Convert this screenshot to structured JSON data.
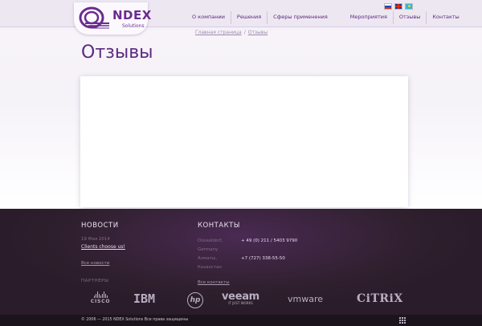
{
  "logo": {
    "name": "NDEX",
    "sub": "Solutions"
  },
  "nav": [
    {
      "label": "О компании"
    },
    {
      "label": "Решения"
    },
    {
      "label": "Сферы применения"
    },
    {
      "label": "Мероприятия"
    },
    {
      "label": "Отзывы"
    },
    {
      "label": "Контакты"
    }
  ],
  "languages": [
    "ru-flag-icon",
    "en-flag-icon",
    "kz-flag-icon"
  ],
  "breadcrumb": {
    "home": "Главная страница",
    "separator": "/",
    "current": "Отзывы"
  },
  "page": {
    "title": "Отзывы"
  },
  "footer": {
    "news": {
      "heading": "НОВОСТИ",
      "date": "19 Мая 2014",
      "link": "Clients choose us!",
      "all": "Все новости"
    },
    "contacts": {
      "heading": "КОНТАКТЫ",
      "rows": [
        {
          "city": "Düsseldorf, Germany",
          "phone": "+ 49 (0) 211 / 5403 9790"
        },
        {
          "city": "Алматы, Казахстан",
          "phone": "+7 (727) 338-55-50"
        }
      ],
      "all": "Все контакты"
    },
    "partners_label": "ПАРТНЕРЫ",
    "partners": {
      "cisco": "CISCO",
      "ibm": "IBM",
      "hp": "hp",
      "veeam": "veeam",
      "veeam_tag": "IT JUST WORKS",
      "vmware": "vmware",
      "citrix": "CiTRiX"
    }
  },
  "copyright": "© 2006 — 2015 NDEX Solutions Все права защищены",
  "colors": {
    "brand": "#5b2a7e",
    "footer_bg": "#30202f"
  }
}
